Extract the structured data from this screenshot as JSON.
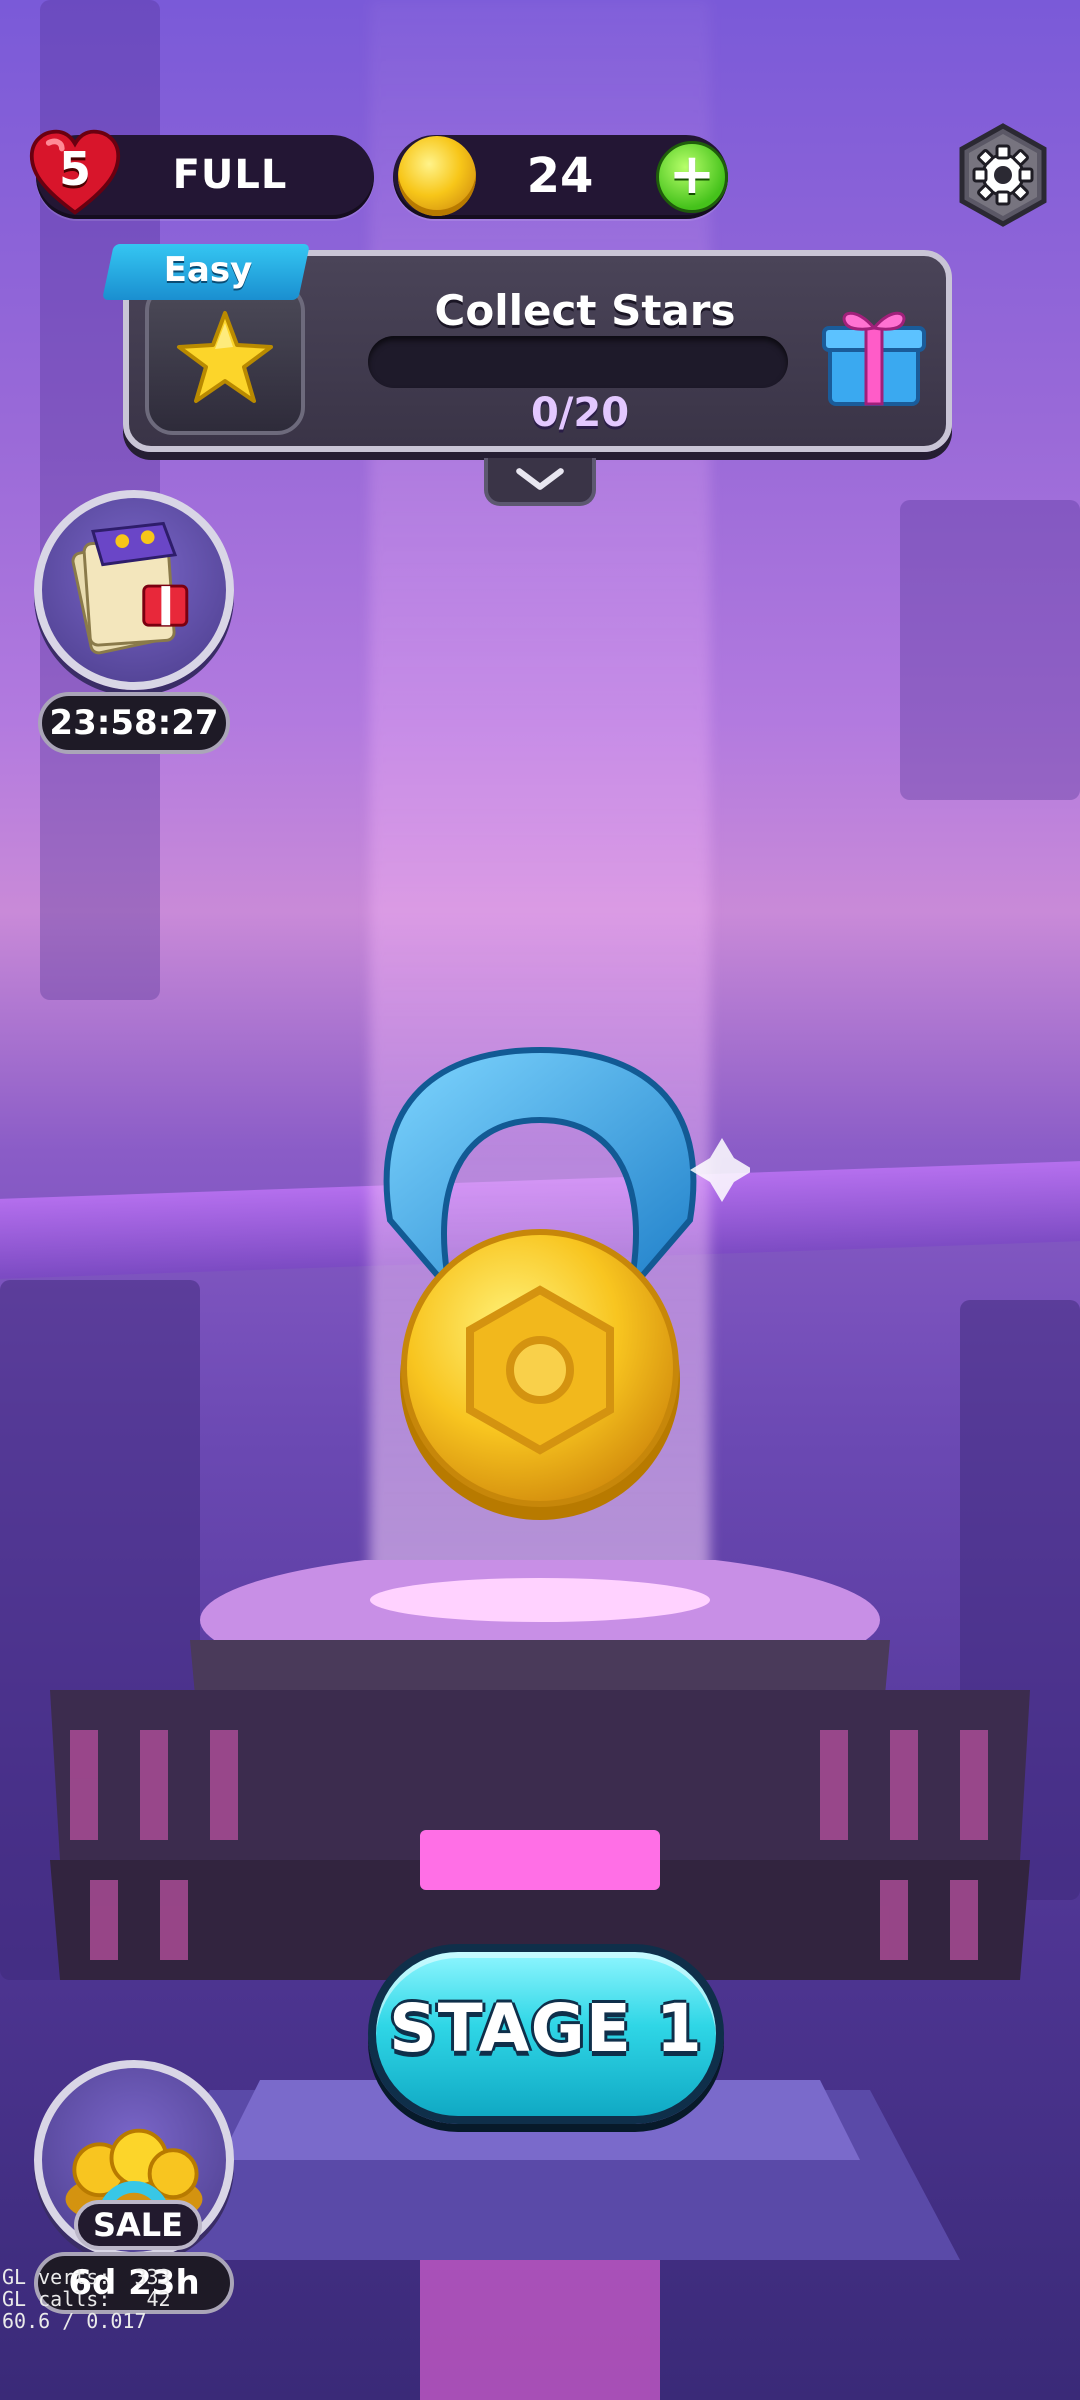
{
  "lives": {
    "count": "5",
    "status": "FULL"
  },
  "coins": {
    "amount": "24",
    "add_label": "+"
  },
  "quest": {
    "difficulty": "Easy",
    "title": "Collect Stars",
    "progress_text": "0/20",
    "progress_fraction": 0
  },
  "offers": {
    "timer_offer_time": "23:58:27",
    "sale_label": "SALE",
    "sale_time": "6d 23h"
  },
  "stage": {
    "label": "STAGE 1"
  },
  "debug": {
    "line1": "GL verts:  333",
    "line2": "GL calls:   42",
    "line3": "60.6 / 0.017"
  },
  "icons": [
    "heart-icon",
    "coin-icon",
    "plus-icon",
    "gear-icon",
    "star-icon",
    "gift-icon",
    "chevron-down-icon",
    "card-deck-icon",
    "coin-pile-icon",
    "medal-icon"
  ],
  "colors": {
    "accent_cyan": "#2fd6e6",
    "coin_gold": "#f7c619",
    "easy_blue": "#35c6f2",
    "plus_green": "#45c21b"
  }
}
